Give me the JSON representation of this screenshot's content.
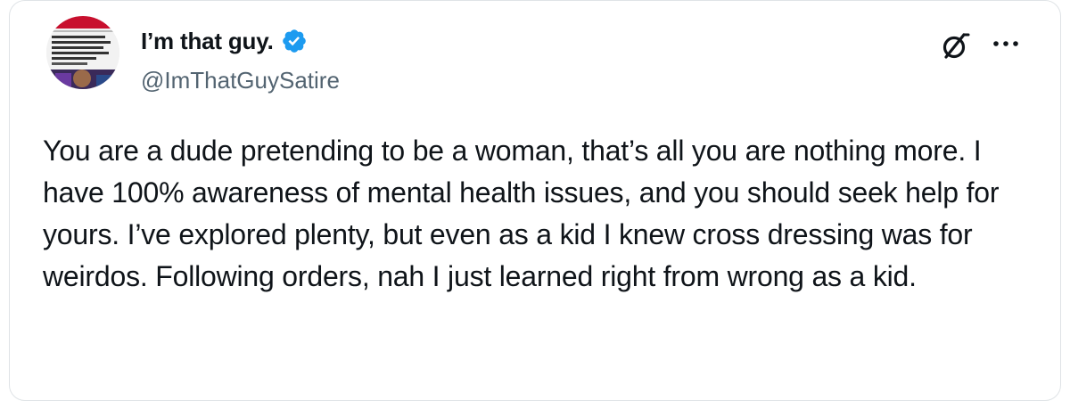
{
  "author": {
    "display_name": "I’m that guy.",
    "handle": "@ImThatGuySatire",
    "verified": true,
    "verified_color": "#1d9bf0"
  },
  "header_actions": {
    "grok_icon": "grok-slash-icon",
    "more_icon": "more-horizontal-icon"
  },
  "tweet": {
    "text": "You are a dude pretending to be a woman, that’s all you are nothing more. I have 100% awareness of mental health issues, and you should seek help for yours. I’ve explored plenty, but even as a kid I knew cross dressing was for weirdos. Following orders, nah I just learned right from wrong as a kid."
  },
  "colors": {
    "text_primary": "#0f1419",
    "text_secondary": "#536471",
    "border": "#dfe3e6"
  }
}
